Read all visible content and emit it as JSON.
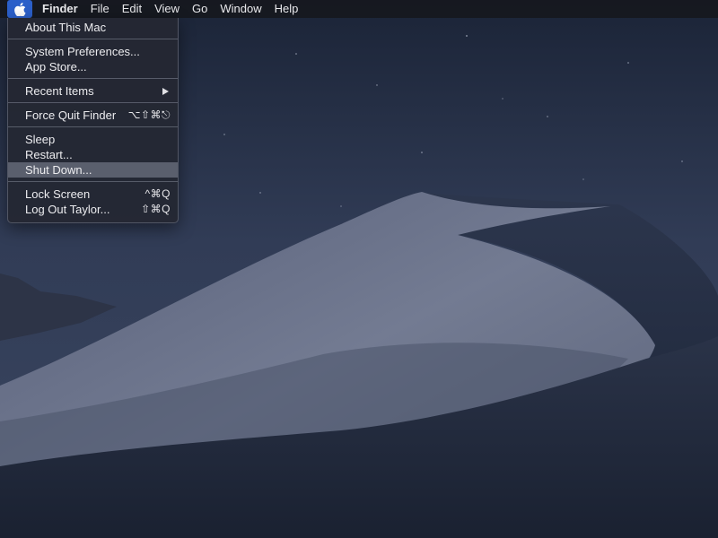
{
  "menubar": {
    "apple_icon": "apple-logo-icon",
    "items": [
      {
        "label": "Finder"
      },
      {
        "label": "File"
      },
      {
        "label": "Edit"
      },
      {
        "label": "View"
      },
      {
        "label": "Go"
      },
      {
        "label": "Window"
      },
      {
        "label": "Help"
      }
    ]
  },
  "apple_menu": {
    "about": {
      "label": "About This Mac"
    },
    "system_preferences": {
      "label": "System Preferences..."
    },
    "app_store": {
      "label": "App Store..."
    },
    "recent_items": {
      "label": "Recent Items",
      "icon": "submenu-arrow-icon"
    },
    "force_quit": {
      "label": "Force Quit Finder",
      "shortcut": "⌥⇧⌘⎋"
    },
    "sleep": {
      "label": "Sleep"
    },
    "restart": {
      "label": "Restart..."
    },
    "shut_down": {
      "label": "Shut Down...",
      "state": "highlighted"
    },
    "lock_screen": {
      "label": "Lock Screen",
      "shortcut": "^⌘Q"
    },
    "log_out": {
      "label": "Log Out Taylor...",
      "shortcut": "⇧⌘Q"
    }
  },
  "colors": {
    "menubar_bg": "#16181e",
    "menu_bg": "#242833",
    "highlight": "#5a5f6d",
    "apple_active": "#2b5fc9",
    "sky_top": "#1c2538",
    "dune_light": "#6f778c",
    "dune_dark": "#1f2738"
  }
}
